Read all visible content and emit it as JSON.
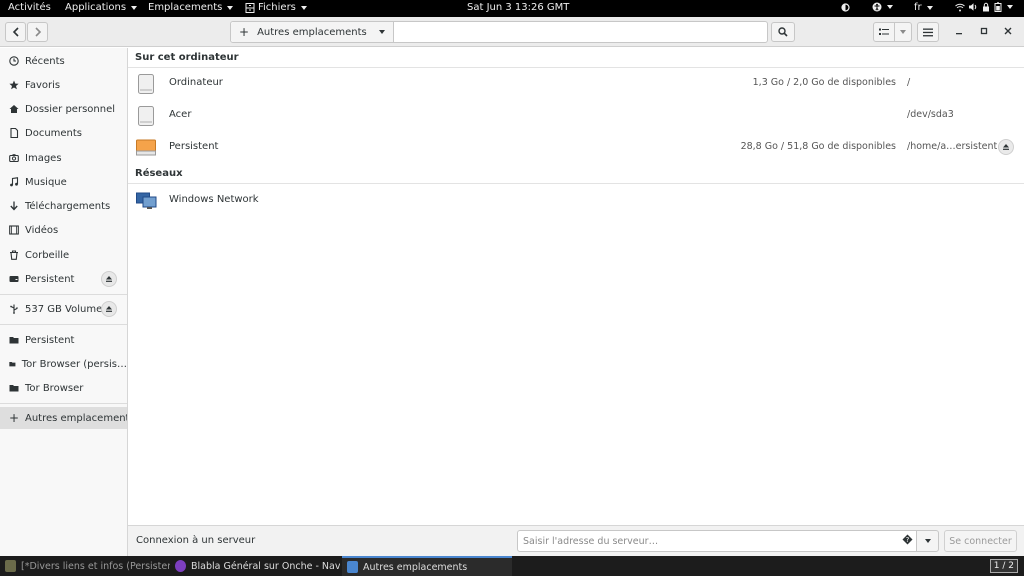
{
  "topbar": {
    "activities": "Activités",
    "applications": "Applications",
    "places": "Emplacements",
    "files_app": "Fichiers",
    "clock": "Sat Jun 3  13:26 GMT",
    "lang": "fr"
  },
  "header": {
    "location_label": "Autres emplacements",
    "add_icon": "+"
  },
  "sidebar": {
    "items": [
      {
        "label": "Récents",
        "icon": "clock-icon"
      },
      {
        "label": "Favoris",
        "icon": "star-icon"
      },
      {
        "label": "Dossier personnel",
        "icon": "home-icon"
      },
      {
        "label": "Documents",
        "icon": "document-icon"
      },
      {
        "label": "Images",
        "icon": "camera-icon"
      },
      {
        "label": "Musique",
        "icon": "music-icon"
      },
      {
        "label": "Téléchargements",
        "icon": "download-icon"
      },
      {
        "label": "Vidéos",
        "icon": "video-icon"
      },
      {
        "label": "Corbeille",
        "icon": "trash-icon"
      },
      {
        "label": "Persistent",
        "icon": "drive-icon"
      }
    ],
    "volumes": [
      {
        "label": "537 GB Volume",
        "icon": "usb-icon"
      }
    ],
    "bookmarks": [
      {
        "label": "Persistent",
        "icon": "folder-icon"
      },
      {
        "label": "Tor Browser (persis…",
        "icon": "folder-icon"
      },
      {
        "label": "Tor Browser",
        "icon": "folder-icon"
      }
    ],
    "other_locations": "Autres emplacements"
  },
  "main": {
    "on_this_computer": "Sur cet ordinateur",
    "devices": [
      {
        "name": "Ordinateur",
        "space": "1,3 Go / 2,0 Go de disponibles",
        "mount": "/",
        "color": "#e8e8e8"
      },
      {
        "name": "Acer",
        "space": "",
        "mount": "/dev/sda3",
        "color": "#e8e8e8"
      },
      {
        "name": "Persistent",
        "space": "28,8 Go / 51,8 Go de disponibles",
        "mount": "/home/a…ersistent",
        "color": "#f5a34a"
      }
    ],
    "networks_title": "Réseaux",
    "networks": [
      {
        "name": "Windows Network"
      }
    ]
  },
  "connect": {
    "label": "Connexion à un serveur",
    "placeholder": "Saisir l'adresse du serveur…",
    "button": "Se connecter"
  },
  "taskbar": {
    "tasks": [
      {
        "label": "[*Divers liens et infos (Persistent – …",
        "color": "#6b6b4a"
      },
      {
        "label": "Blabla Général sur Onche - Naviga…",
        "color": "#7d3fc0"
      },
      {
        "label": "Autres emplacements",
        "color": "#4a86cf"
      }
    ],
    "pager": "1 / 2"
  }
}
